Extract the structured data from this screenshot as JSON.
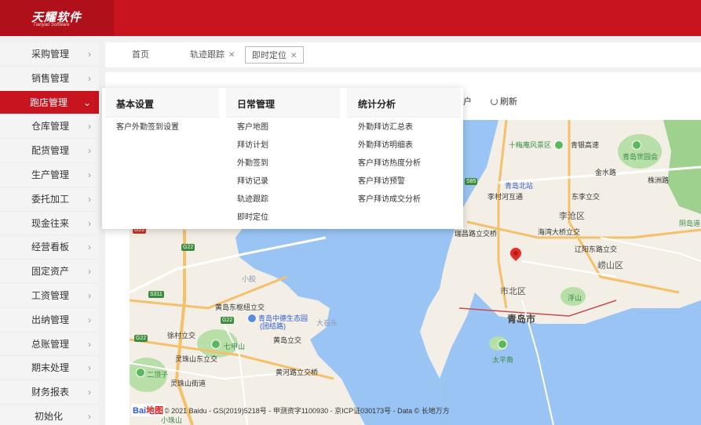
{
  "brand": {
    "name": "天耀软件",
    "sub": "Tianyao Software"
  },
  "sidebar": {
    "items": [
      {
        "label": "采购管理"
      },
      {
        "label": "销售管理"
      },
      {
        "label": "跑店管理",
        "active": true
      },
      {
        "label": "仓库管理"
      },
      {
        "label": "配货管理"
      },
      {
        "label": "生产管理"
      },
      {
        "label": "委托加工"
      },
      {
        "label": "现金往来"
      },
      {
        "label": "经营看板"
      },
      {
        "label": "固定资产"
      },
      {
        "label": "工资管理"
      },
      {
        "label": "出纳管理"
      },
      {
        "label": "总账管理"
      },
      {
        "label": "期末处理"
      },
      {
        "label": "财务报表"
      },
      {
        "label": "初始化"
      }
    ]
  },
  "tabs": [
    {
      "label": "首页",
      "closable": false
    },
    {
      "label": "轨迹跟踪",
      "closable": true
    },
    {
      "label": "即时定位",
      "closable": true,
      "active": true
    }
  ],
  "toolbar": {
    "partial_label": "户",
    "refresh_label": "刷新"
  },
  "dropdown": {
    "columns": [
      {
        "title": "基本设置",
        "items": [
          "客户外勤签到设置"
        ]
      },
      {
        "title": "日常管理",
        "items": [
          "客户地图",
          "拜访计划",
          "外勤签到",
          "拜访记录",
          "轨迹跟踪",
          "即时定位"
        ]
      },
      {
        "title": "统计分析",
        "items": [
          "外勤拜访汇总表",
          "外勤拜访明细表",
          "客户拜访热度分析",
          "客户拜访预警",
          "客户拜访成交分析"
        ]
      }
    ]
  },
  "map": {
    "labels": [
      {
        "text": "十梅庵风景区"
      },
      {
        "text": "青银高速"
      },
      {
        "text": "金水路"
      },
      {
        "text": "青岛世园会"
      },
      {
        "text": "青岛北站"
      },
      {
        "text": "李村河互通"
      },
      {
        "text": "东李立交"
      },
      {
        "text": "李沧区"
      },
      {
        "text": "海湾大桥立交"
      },
      {
        "text": "瑞昌路立交桥"
      },
      {
        "text": "辽阳东路立交"
      },
      {
        "text": "崂山区"
      },
      {
        "text": "市北区"
      },
      {
        "text": "浮山"
      },
      {
        "text": "青岛市"
      },
      {
        "text": "太平角"
      },
      {
        "text": "黄岛东枢纽立交"
      },
      {
        "text": "青岛中德生态园"
      },
      {
        "text": "(团结路)"
      },
      {
        "text": "徐村立交"
      },
      {
        "text": "七甲山"
      },
      {
        "text": "黄岛立交"
      },
      {
        "text": "灵珠山东立交"
      },
      {
        "text": "黄河路立交桥"
      },
      {
        "text": "二顶子"
      },
      {
        "text": "灵珠山街道"
      },
      {
        "text": "小珠山"
      },
      {
        "text": "阴岛道"
      },
      {
        "text": "大石头"
      },
      {
        "text": "小胶"
      },
      {
        "text": "株洲路"
      }
    ],
    "shields": [
      "G22",
      "G22",
      "S311",
      "G22",
      "S85",
      "G22"
    ],
    "copyright": "© 2021 Baidu - GS(2019)5218号 - 甲测资字1100930 - 京ICP证030173号 - Data © 长地万方",
    "logo": {
      "a": "Bai",
      "b": "地图"
    }
  },
  "colors": {
    "brand_red": "#c8141e",
    "sea": "#99c4f3",
    "land": "#f3efe6",
    "green": "#b8dfa8"
  }
}
